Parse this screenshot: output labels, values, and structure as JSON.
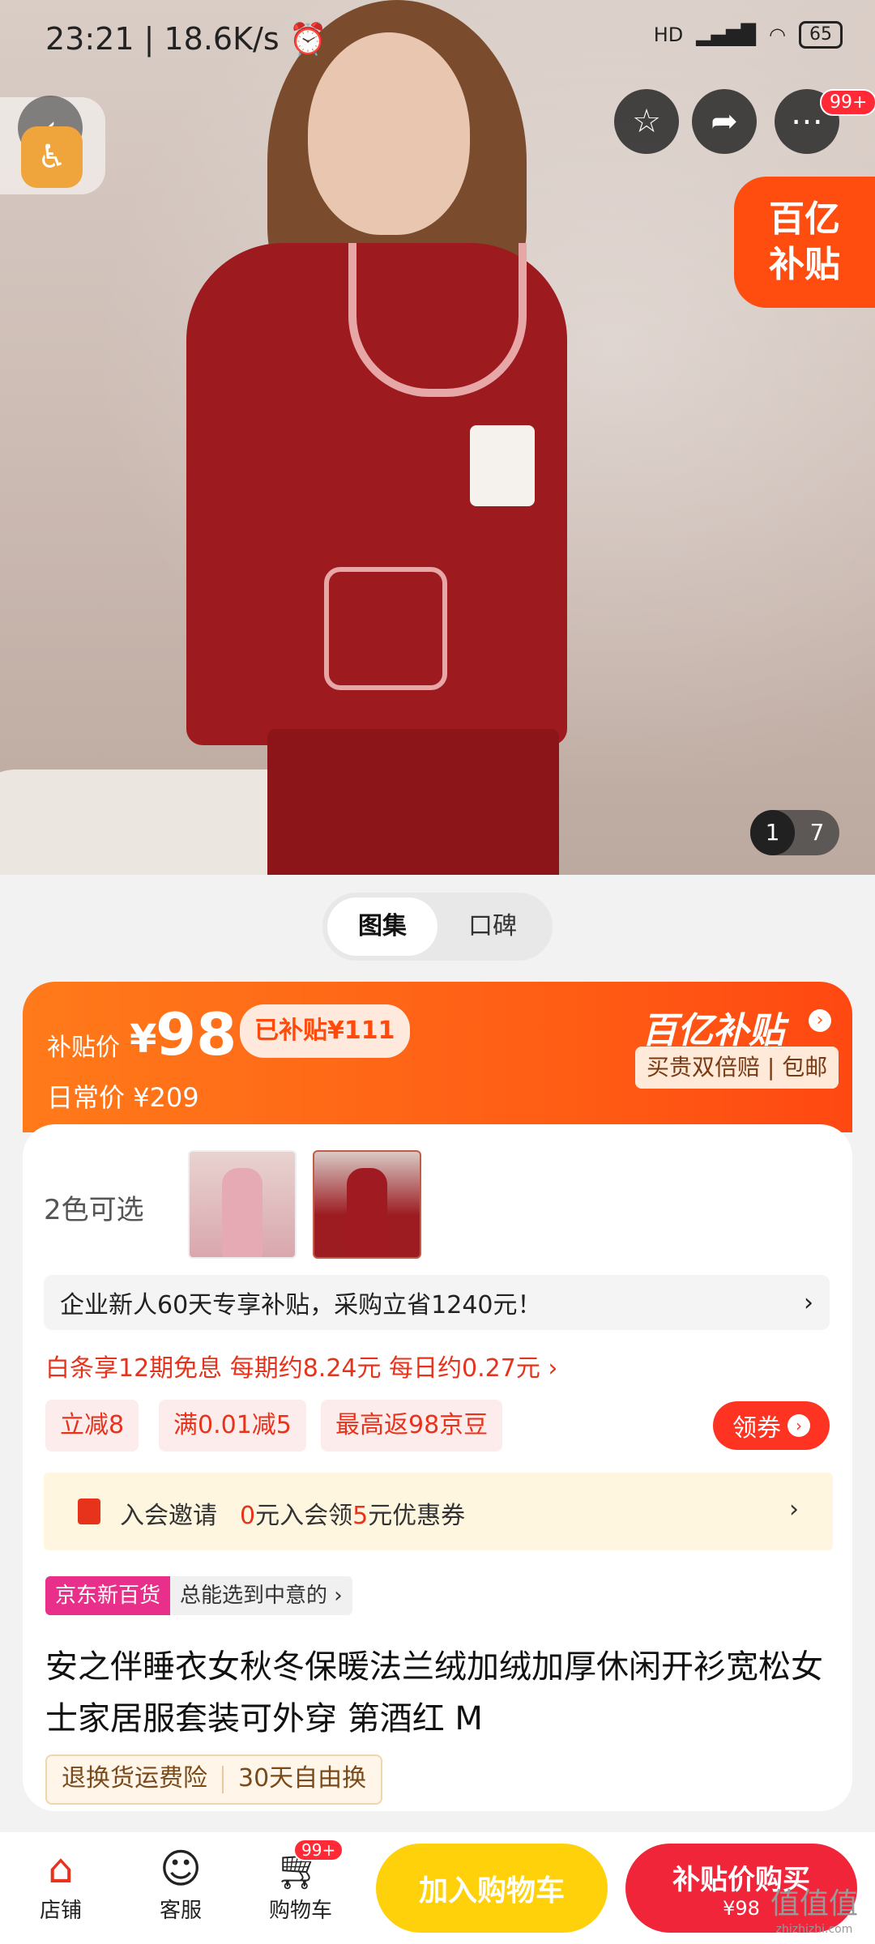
{
  "status_bar": {
    "time": "23:21",
    "speed": "18.6K/s",
    "network": "HD",
    "battery": "65"
  },
  "top_actions": {
    "more_badge": "99+"
  },
  "hero": {
    "subsidy_tag_line1": "百亿",
    "subsidy_tag_line2": "补贴",
    "counter_current": "1",
    "counter_total": "7"
  },
  "tabs": [
    {
      "label": "图集",
      "active": true
    },
    {
      "label": "口碑",
      "active": false
    }
  ],
  "price": {
    "label": "补贴价",
    "currency": "¥",
    "value": "98",
    "subsidized": "已补贴¥111",
    "daily_label": "日常价",
    "daily_value": "¥209",
    "program": "百亿补贴",
    "program_promise": "买贵双倍赔 | 包邮"
  },
  "options": {
    "color_count": "2色可选"
  },
  "promo_bar": {
    "text": "企业新人60天专享补贴，采购立省1240元！",
    "arrow": "›"
  },
  "baitiao": "白条享12期免息  每期约8.24元  每日约0.27元 ›",
  "coupons": [
    "立减8",
    "满0.01减5",
    "最高返98京豆"
  ],
  "get_coupon": "领券",
  "member": {
    "label": "入会邀请",
    "pre": "0",
    "mid": "元入会领",
    "amount": "5",
    "post": "元优惠券",
    "arrow": "›"
  },
  "jd_new": {
    "tag": "京东新百货",
    "text": "总能选到中意的 ›"
  },
  "product_title": "安之伴睡衣女秋冬保暖法兰绒加绒加厚休闲开衫宽松女士家居服套装可外穿 第酒红 M",
  "service_tags": [
    "退换货运费险",
    "30天自由换"
  ],
  "bottom_nav": {
    "store": "店铺",
    "service": "客服",
    "cart": "购物车",
    "cart_badge": "99+",
    "add_cart": "加入购物车",
    "buy_now": "补贴价购买",
    "buy_now_price": "¥98"
  },
  "watermark": {
    "text": "值值值",
    "url": "zhizhizhi.com"
  },
  "colors": {
    "accent_orange": "#ff5a14",
    "accent_red": "#e8331c",
    "cta_yellow": "#ffd10a",
    "cta_red": "#f0253a"
  }
}
